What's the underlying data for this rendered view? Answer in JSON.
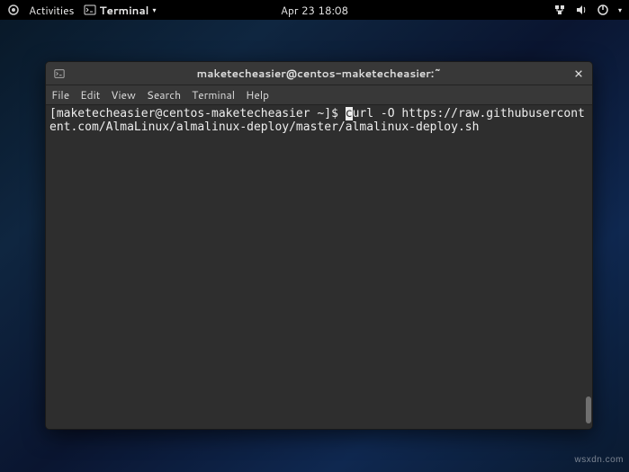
{
  "panel": {
    "activities": "Activities",
    "app_name": "Terminal",
    "datetime": "Apr 23  18:08"
  },
  "window": {
    "title": "maketecheasier@centos-maketecheasier:~",
    "menubar": {
      "file": "File",
      "edit": "Edit",
      "view": "View",
      "search": "Search",
      "terminal": "Terminal",
      "help": "Help"
    },
    "prompt": "[maketecheasier@centos-maketecheasier ~]$ ",
    "cursor_char": "c",
    "command_rest": "url -O https://raw.githubusercontent.com/AlmaLinux/almalinux-deploy/master/almalinux-deploy.sh"
  },
  "watermark": "wsxdn.com"
}
